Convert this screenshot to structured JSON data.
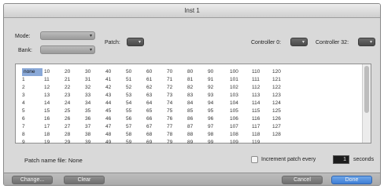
{
  "window": {
    "title": "Inst 1"
  },
  "controls": {
    "mode_label": "Mode:",
    "bank_label": "Bank:",
    "patch_label": "Patch:",
    "controller0_label": "Controller 0:",
    "controller32_label": "Controller 32:"
  },
  "patch_grid": {
    "selected": "none",
    "columns": [
      [
        "none",
        "1",
        "2",
        "3",
        "4",
        "5",
        "6",
        "7",
        "8",
        "9"
      ],
      [
        "10",
        "11",
        "12",
        "13",
        "14",
        "15",
        "16",
        "17",
        "18",
        "19"
      ],
      [
        "20",
        "21",
        "22",
        "23",
        "24",
        "25",
        "26",
        "27",
        "28",
        "29"
      ],
      [
        "30",
        "31",
        "32",
        "33",
        "34",
        "35",
        "36",
        "37",
        "38",
        "39"
      ],
      [
        "40",
        "41",
        "42",
        "43",
        "44",
        "45",
        "46",
        "47",
        "48",
        "49"
      ],
      [
        "50",
        "51",
        "52",
        "53",
        "54",
        "55",
        "56",
        "57",
        "58",
        "59"
      ],
      [
        "60",
        "61",
        "62",
        "63",
        "64",
        "65",
        "66",
        "67",
        "68",
        "69"
      ],
      [
        "70",
        "71",
        "72",
        "73",
        "74",
        "75",
        "76",
        "77",
        "78",
        "79"
      ],
      [
        "80",
        "81",
        "82",
        "83",
        "84",
        "85",
        "86",
        "87",
        "88",
        "89"
      ],
      [
        "90",
        "91",
        "92",
        "93",
        "94",
        "95",
        "96",
        "97",
        "98",
        "99"
      ],
      [
        "100",
        "101",
        "102",
        "103",
        "104",
        "105",
        "106",
        "107",
        "108",
        "109"
      ],
      [
        "110",
        "111",
        "112",
        "113",
        "114",
        "115",
        "116",
        "117",
        "118",
        "119"
      ],
      [
        "120",
        "121",
        "122",
        "123",
        "124",
        "125",
        "126",
        "127",
        "128"
      ]
    ]
  },
  "footer": {
    "patch_name_file": "Patch name file: None",
    "increment_label": "Increment patch every",
    "increment_value": "1",
    "seconds_label": "seconds"
  },
  "buttons": {
    "change": "Change...",
    "clear": "Clear",
    "cancel": "Cancel",
    "done": "Done"
  }
}
